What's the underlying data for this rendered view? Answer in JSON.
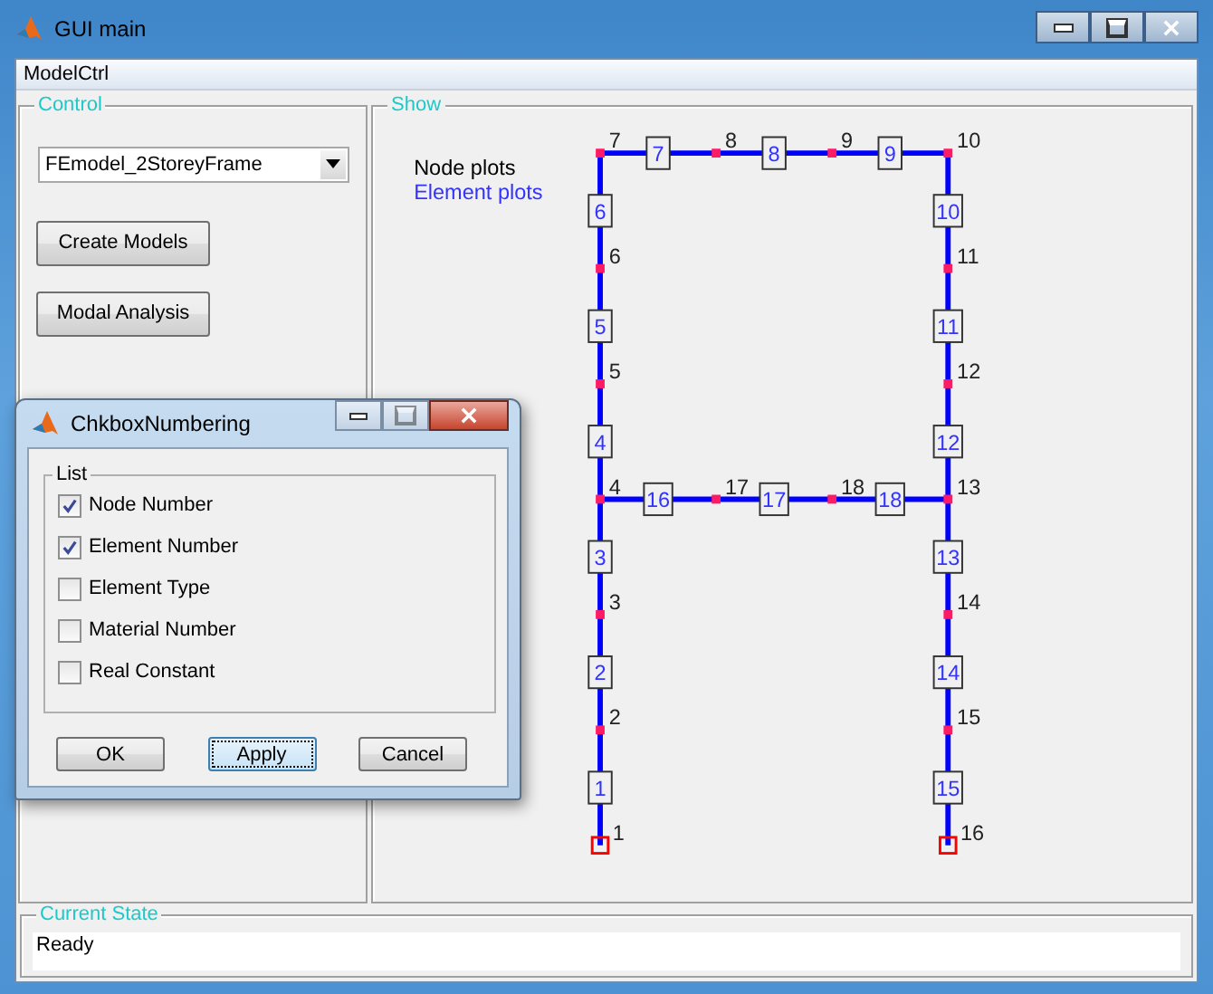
{
  "window": {
    "title": "GUI main"
  },
  "menu": [
    {
      "label": "ModelCtrl"
    }
  ],
  "control_panel": {
    "title": "Control",
    "model_select": {
      "value": "FEmodel_2StoreyFrame"
    },
    "buttons": [
      "Create Models",
      "Modal Analysis"
    ]
  },
  "show_panel": {
    "title": "Show",
    "legend": [
      {
        "label": "Node plots",
        "kind": "node"
      },
      {
        "label": "Element plots",
        "kind": "element"
      }
    ],
    "frame": {
      "nodes": [
        {
          "label": "7",
          "support": false
        },
        {
          "label": "8",
          "support": false
        },
        {
          "label": "9",
          "support": false
        },
        {
          "label": "10",
          "support": false
        },
        {
          "label": "6",
          "support": false
        },
        {
          "label": "11",
          "support": false
        },
        {
          "label": "5",
          "support": false
        },
        {
          "label": "12",
          "support": false
        },
        {
          "label": "4",
          "support": false
        },
        {
          "label": "17",
          "support": false
        },
        {
          "label": "18",
          "support": false
        },
        {
          "label": "13",
          "support": false
        },
        {
          "label": "3",
          "support": false
        },
        {
          "label": "14",
          "support": false
        },
        {
          "label": "2",
          "support": false
        },
        {
          "label": "15",
          "support": false
        },
        {
          "label": "1",
          "support": true
        },
        {
          "label": "16",
          "support": true
        }
      ],
      "elements": [
        {
          "label": "7"
        },
        {
          "label": "8"
        },
        {
          "label": "9"
        },
        {
          "label": "6"
        },
        {
          "label": "10"
        },
        {
          "label": "5"
        },
        {
          "label": "11"
        },
        {
          "label": "4"
        },
        {
          "label": "12"
        },
        {
          "label": "16"
        },
        {
          "label": "17"
        },
        {
          "label": "18"
        },
        {
          "label": "3"
        },
        {
          "label": "13"
        },
        {
          "label": "2"
        },
        {
          "label": "14"
        },
        {
          "label": "1"
        },
        {
          "label": "15"
        }
      ]
    }
  },
  "status": {
    "title": "Current State",
    "text": "Ready"
  },
  "dialog": {
    "title": "ChkboxNumbering",
    "list_title": "List",
    "options": [
      {
        "label": "Node Number",
        "checked": true
      },
      {
        "label": "Element Number",
        "checked": true
      },
      {
        "label": "Element Type",
        "checked": false
      },
      {
        "label": "Material Number",
        "checked": false
      },
      {
        "label": "Real Constant",
        "checked": false
      }
    ],
    "buttons": [
      {
        "label": "OK",
        "focused": false
      },
      {
        "label": "Apply",
        "focused": true
      },
      {
        "label": "Cancel",
        "focused": false
      }
    ]
  }
}
